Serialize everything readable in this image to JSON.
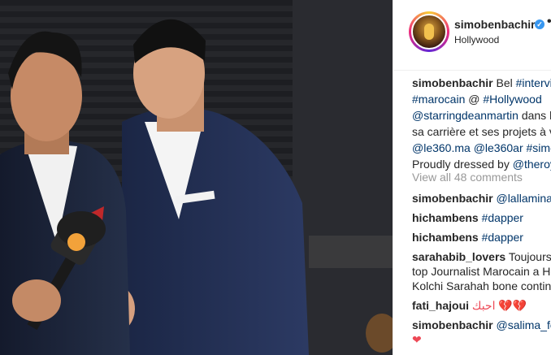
{
  "header": {
    "username": "simobenbachir",
    "verified_icon": "verified-badge-icon",
    "more_icon": "more-dots-icon",
    "location": "Hollywood"
  },
  "caption": {
    "line1_user": "simobenbachir",
    "line1_text": "Bel ",
    "line1_tag": "#intervie",
    "line2_tag1": "#marocain",
    "line2_text": " @ ",
    "line2_tag2": "#Hollywood",
    "line3_tag": "@starringdeanmartin",
    "line3_text": " dans l",
    "line4_text": "sa carrière et ses projets à ve",
    "line5_tag1": "@le360.ma",
    "line5_tag2": "@le360ar",
    "line5_tag3": "#simo",
    "line6_text": "Proudly dressed by ",
    "line6_tag": "@theroy"
  },
  "view_all": "View all 48 comments",
  "comments": [
    {
      "user": "simobenbachir",
      "text": "",
      "tag": "@lallaminala"
    },
    {
      "user": "hichambens",
      "text": "",
      "tag": "#dapper"
    },
    {
      "user": "hichambens",
      "text": "",
      "tag": "#dapper"
    },
    {
      "user": "sarahabib_lovers",
      "text": "Toujours a",
      "tag": ""
    },
    {
      "user": "",
      "text": "top Journalist Marocain a Ho",
      "tag": ""
    },
    {
      "user": "",
      "text": "Kolchi Sarahah bone continu",
      "tag": ""
    },
    {
      "user": "fati_hajoui",
      "text": "احبك 💔💔",
      "tag": ""
    },
    {
      "user": "simobenbachir",
      "text": "",
      "tag": "@salima_fer"
    },
    {
      "user": "",
      "text": "❤",
      "tag": ""
    }
  ]
}
